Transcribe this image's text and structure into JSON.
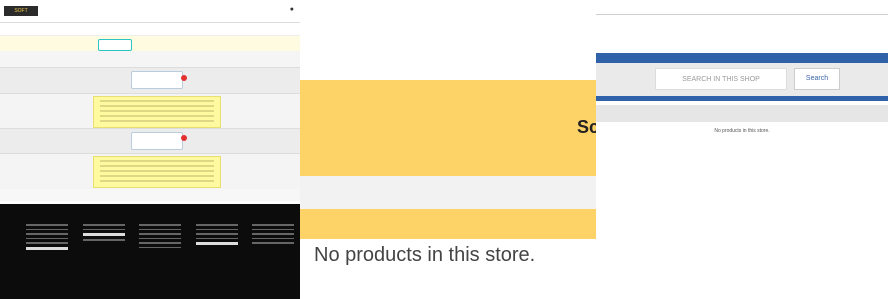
{
  "panel1": {
    "logo_text": "SOFT",
    "nav": [
      "",
      "",
      "",
      "",
      "",
      "",
      ""
    ],
    "icons": [
      "search-icon",
      "menu-icon"
    ],
    "breadcrumb": "",
    "tabs": [
      "",
      "",
      "",
      "",
      "",
      ""
    ],
    "active_tab_index": 3,
    "notice": "",
    "options": [
      {
        "title": "",
        "subtitle": ""
      },
      {
        "title": "",
        "subtitle": ""
      }
    ],
    "footer_note": "",
    "footer_columns": [
      "",
      "",
      "",
      "",
      ""
    ]
  },
  "panel2": {
    "banner_text": "Sc",
    "empty_message": "No products in this store."
  },
  "panel3": {
    "nav_links": [
      "",
      "",
      ""
    ],
    "search_placeholder": "SEARCH IN THIS SHOP",
    "search_button": "Search",
    "empty_message": "No products in this store.",
    "accent_color": "#2f62a8"
  }
}
